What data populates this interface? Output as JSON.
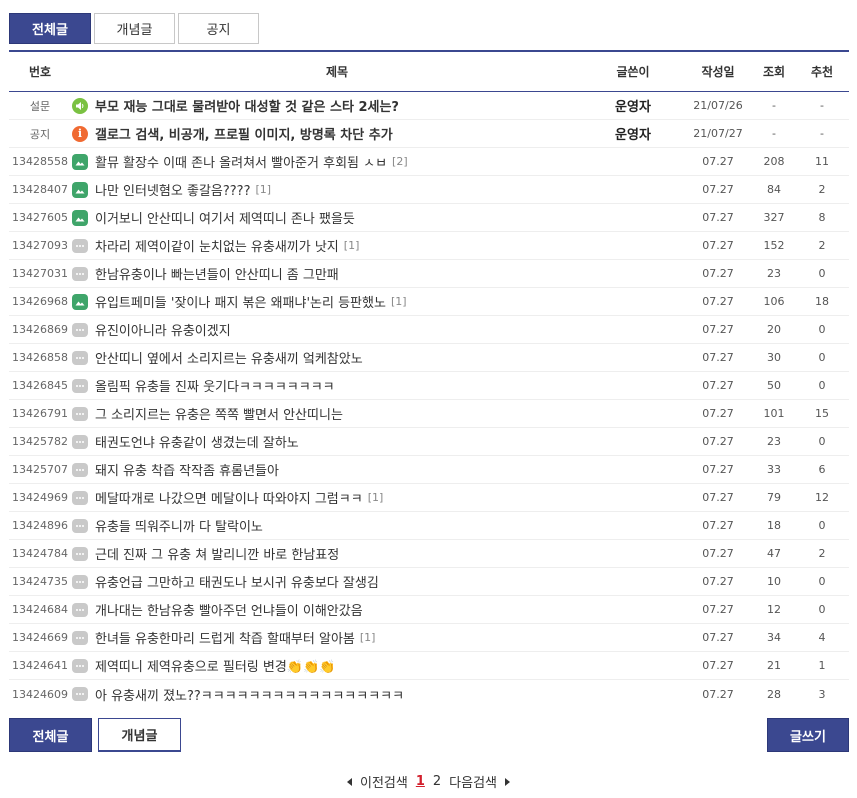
{
  "tabs": [
    {
      "label": "전체글",
      "active": true
    },
    {
      "label": "개념글",
      "active": false
    },
    {
      "label": "공지",
      "active": false
    }
  ],
  "columns": {
    "num": "번호",
    "subject": "제목",
    "writer": "글쓴이",
    "date": "작성일",
    "views": "조회",
    "recommend": "추천"
  },
  "notices": [
    {
      "num": "설문",
      "icon": "speaker-icon",
      "title": "부모 재능 그대로 물려받아 대성할 것 같은 스타 2세는?",
      "writer": "운영자",
      "date": "21/07/26",
      "views": "-",
      "recommend": "-"
    },
    {
      "num": "공지",
      "icon": "info-icon",
      "title": "갤로그 검색, 비공개, 프로필 이미지, 방명록 차단 추가",
      "writer": "운영자",
      "date": "21/07/27",
      "views": "-",
      "recommend": "-"
    }
  ],
  "posts": [
    {
      "num": "13428558",
      "icon": "image-icon",
      "title": "활뮤 활장수 이때 존나 올려쳐서 빨아준거 후회됨 ㅅㅂ",
      "replies": "[2]",
      "date": "07.27",
      "views": "208",
      "recommend": "11"
    },
    {
      "num": "13428407",
      "icon": "image-icon",
      "title": "나만 인터넷혐오 좋갈음????",
      "replies": "[1]",
      "date": "07.27",
      "views": "84",
      "recommend": "2"
    },
    {
      "num": "13427605",
      "icon": "image-icon",
      "title": "이거보니 안산띠니 여기서 제역띠니 존나 팼을듯",
      "replies": "",
      "date": "07.27",
      "views": "327",
      "recommend": "8"
    },
    {
      "num": "13427093",
      "icon": "text-icon",
      "title": "차라리 제역이같이 눈치없는 유충새끼가 낫지",
      "replies": "[1]",
      "date": "07.27",
      "views": "152",
      "recommend": "2"
    },
    {
      "num": "13427031",
      "icon": "text-icon",
      "title": "한남유충이나 빠는년들이 안산띠니 좀 그만패",
      "replies": "",
      "date": "07.27",
      "views": "23",
      "recommend": "0"
    },
    {
      "num": "13426968",
      "icon": "image-icon",
      "title": "유입트페미들 '잦이나 패지 볶은 왜패냐'논리 등판했노",
      "replies": "[1]",
      "date": "07.27",
      "views": "106",
      "recommend": "18"
    },
    {
      "num": "13426869",
      "icon": "text-icon",
      "title": "유진이아니라 유충이겠지",
      "replies": "",
      "date": "07.27",
      "views": "20",
      "recommend": "0"
    },
    {
      "num": "13426858",
      "icon": "text-icon",
      "title": "안산띠니 옆에서 소리지르는 유충새끼 엌케참았노",
      "replies": "",
      "date": "07.27",
      "views": "30",
      "recommend": "0"
    },
    {
      "num": "13426845",
      "icon": "text-icon",
      "title": "올림픽 유충들 진짜 웃기다ㅋㅋㅋㅋㅋㅋㅋㅋ",
      "replies": "",
      "date": "07.27",
      "views": "50",
      "recommend": "0"
    },
    {
      "num": "13426791",
      "icon": "text-icon",
      "title": "그 소리지르는 유충은 쪽쪽 빨면서 안산띠니는",
      "replies": "",
      "date": "07.27",
      "views": "101",
      "recommend": "15"
    },
    {
      "num": "13425782",
      "icon": "text-icon",
      "title": "태권도언냐 유충같이 생겼는데 잘하노",
      "replies": "",
      "date": "07.27",
      "views": "23",
      "recommend": "0"
    },
    {
      "num": "13425707",
      "icon": "text-icon",
      "title": "돼지 유충 착즙 작작좀 휴롬년들아",
      "replies": "",
      "date": "07.27",
      "views": "33",
      "recommend": "6"
    },
    {
      "num": "13424969",
      "icon": "text-icon",
      "title": "메달따개로 나갔으면 메달이나 따와야지 그럼ㅋㅋ",
      "replies": "[1]",
      "date": "07.27",
      "views": "79",
      "recommend": "12"
    },
    {
      "num": "13424896",
      "icon": "text-icon",
      "title": "유충들 띄워주니까 다 탈락이노",
      "replies": "",
      "date": "07.27",
      "views": "18",
      "recommend": "0"
    },
    {
      "num": "13424784",
      "icon": "text-icon",
      "title": "근데 진짜 그 유충 쳐 발리니깐 바로 한남표정",
      "replies": "",
      "date": "07.27",
      "views": "47",
      "recommend": "2"
    },
    {
      "num": "13424735",
      "icon": "text-icon",
      "title": "유충언급 그만하고 태권도나 보시귀 유충보다 잘생김",
      "replies": "",
      "date": "07.27",
      "views": "10",
      "recommend": "0"
    },
    {
      "num": "13424684",
      "icon": "text-icon",
      "title": "개나대는 한남유충 빨아주던 언냐들이 이해안갔음",
      "replies": "",
      "date": "07.27",
      "views": "12",
      "recommend": "0"
    },
    {
      "num": "13424669",
      "icon": "text-icon",
      "title": "한녀들 유충한마리 드럽게 착즙 할때부터 알아봄",
      "replies": "[1]",
      "date": "07.27",
      "views": "34",
      "recommend": "4"
    },
    {
      "num": "13424641",
      "icon": "text-icon",
      "title": "제역띠니 제역유충으로 필터링 변경👏👏👏",
      "replies": "",
      "date": "07.27",
      "views": "21",
      "recommend": "1"
    },
    {
      "num": "13424609",
      "icon": "text-icon",
      "title": "아 유충새끼 졌노??ㅋㅋㅋㅋㅋㅋㅋㅋㅋㅋㅋㅋㅋㅋㅋㅋㅋ",
      "replies": "",
      "date": "07.27",
      "views": "28",
      "recommend": "3"
    }
  ],
  "bottom": {
    "all_label": "전체글",
    "best_label": "개념글",
    "write_label": "글쓰기"
  },
  "pagination": {
    "prev_label": "이전검색",
    "pages": [
      "1",
      "2"
    ],
    "current": "1",
    "next_label": "다음검색"
  },
  "colors": {
    "accent": "#3b4890",
    "current_page": "#d21f2c",
    "notice_sound": "#7ac142",
    "notice_info": "#f06a32",
    "image_icon": "#3fa56a"
  }
}
